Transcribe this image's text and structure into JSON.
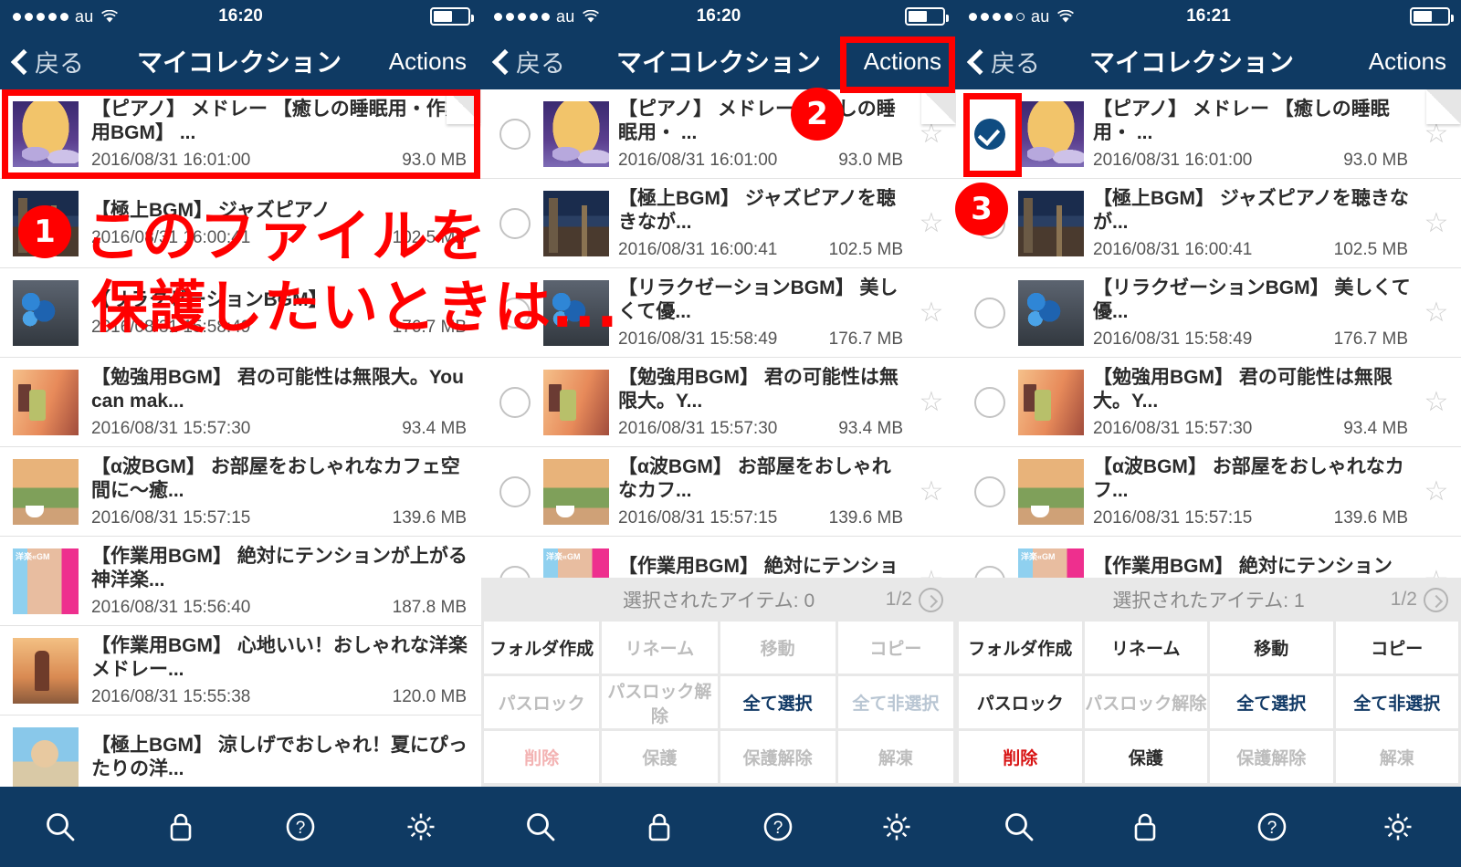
{
  "panels": [
    {
      "status": {
        "dots_filled": 5,
        "dots_total": 5,
        "carrier": "au",
        "time": "16:20",
        "battery_pct": 55
      },
      "nav": {
        "back": "戻る",
        "title": "マイコレクション",
        "actions": "Actions"
      },
      "mode": "plain",
      "rows": [
        {
          "title": "【ピアノ】 メドレー 【癒しの睡眠用・作業用BGM】 ...",
          "date": "2016/08/31 16:01:00",
          "size": "93.0 MB",
          "thumb": "t-moon",
          "corner": true,
          "selected": false
        },
        {
          "title": "【極上BGM】 ジャズピアノ",
          "date": "2016/08/31 16:00:41",
          "size": "102.5 MB",
          "thumb": "t-night",
          "corner": false,
          "selected": false
        },
        {
          "title": "【リラクゼーションBGM】",
          "date": "2016/08/31 15:58:49",
          "size": "176.7 MB",
          "thumb": "t-flower",
          "corner": false,
          "selected": false
        },
        {
          "title": "【勉強用BGM】 君の可能性は無限大。You can mak...",
          "date": "2016/08/31 15:57:30",
          "size": "93.4 MB",
          "thumb": "t-study",
          "corner": false,
          "selected": false
        },
        {
          "title": "【α波BGM】 お部屋をおしゃれなカフェ空間に〜癒...",
          "date": "2016/08/31 15:57:15",
          "size": "139.6 MB",
          "thumb": "t-cafe",
          "corner": false,
          "selected": false
        },
        {
          "title": "【作業用BGM】 絶対にテンションが上がる神洋楽...",
          "date": "2016/08/31 15:56:40",
          "size": "187.8 MB",
          "thumb": "t-idol",
          "corner": false,
          "selected": false
        },
        {
          "title": "【作業用BGM】 心地いい！おしゃれな洋楽メドレー...",
          "date": "2016/08/31 15:55:38",
          "size": "120.0 MB",
          "thumb": "t-walk",
          "corner": false,
          "selected": false
        },
        {
          "title": "【極上BGM】 涼しげでおしゃれ！夏にぴったりの洋...",
          "date": "",
          "size": "",
          "thumb": "t-beach",
          "corner": false,
          "selected": false
        }
      ],
      "sheet": null
    },
    {
      "status": {
        "dots_filled": 5,
        "dots_total": 5,
        "carrier": "au",
        "time": "16:20",
        "battery_pct": 55
      },
      "nav": {
        "back": "戻る",
        "title": "マイコレクション",
        "actions": "Actions"
      },
      "mode": "select",
      "rows": [
        {
          "title": "【ピアノ】 メドレー 【癒しの睡眠用・ ...",
          "date": "2016/08/31 16:01:00",
          "size": "93.0 MB",
          "thumb": "t-moon",
          "corner": true,
          "selected": false
        },
        {
          "title": "【極上BGM】 ジャズピアノを聴きなが...",
          "date": "2016/08/31 16:00:41",
          "size": "102.5 MB",
          "thumb": "t-night",
          "corner": false,
          "selected": false
        },
        {
          "title": "【リラクゼーションBGM】 美しくて優...",
          "date": "2016/08/31 15:58:49",
          "size": "176.7 MB",
          "thumb": "t-flower",
          "corner": false,
          "selected": false
        },
        {
          "title": "【勉強用BGM】 君の可能性は無限大。Y...",
          "date": "2016/08/31 15:57:30",
          "size": "93.4 MB",
          "thumb": "t-study",
          "corner": false,
          "selected": false
        },
        {
          "title": "【α波BGM】 お部屋をおしゃれなカフ...",
          "date": "2016/08/31 15:57:15",
          "size": "139.6 MB",
          "thumb": "t-cafe",
          "corner": false,
          "selected": false
        },
        {
          "title": "【作業用BGM】 絶対にテンションが...",
          "date": "",
          "size": "",
          "thumb": "t-idol",
          "corner": false,
          "selected": false
        }
      ],
      "sheet": {
        "count_label": "選択されたアイテム: 0",
        "page": "1/2",
        "buttons": [
          {
            "label": "フォルダ作成",
            "state": "enabled"
          },
          {
            "label": "リネーム",
            "state": "disabled"
          },
          {
            "label": "移動",
            "state": "disabled"
          },
          {
            "label": "コピー",
            "state": "disabled"
          },
          {
            "label": "パスロック",
            "state": "disabled"
          },
          {
            "label": "パスロック解除",
            "state": "disabled"
          },
          {
            "label": "全て選択",
            "state": "blue"
          },
          {
            "label": "全て非選択",
            "state": "blue-disabled"
          },
          {
            "label": "削除",
            "state": "red-disabled"
          },
          {
            "label": "保護",
            "state": "disabled"
          },
          {
            "label": "保護解除",
            "state": "disabled"
          },
          {
            "label": "解凍",
            "state": "disabled"
          }
        ]
      }
    },
    {
      "status": {
        "dots_filled": 4,
        "dots_total": 5,
        "carrier": "au",
        "time": "16:21",
        "battery_pct": 55
      },
      "nav": {
        "back": "戻る",
        "title": "マイコレクション",
        "actions": "Actions"
      },
      "mode": "select",
      "rows": [
        {
          "title": "【ピアノ】 メドレー 【癒しの睡眠用・ ...",
          "date": "2016/08/31 16:01:00",
          "size": "93.0 MB",
          "thumb": "t-moon",
          "corner": true,
          "selected": true
        },
        {
          "title": "【極上BGM】 ジャズピアノを聴きなが...",
          "date": "2016/08/31 16:00:41",
          "size": "102.5 MB",
          "thumb": "t-night",
          "corner": false,
          "selected": false
        },
        {
          "title": "【リラクゼーションBGM】 美しくて優...",
          "date": "2016/08/31 15:58:49",
          "size": "176.7 MB",
          "thumb": "t-flower",
          "corner": false,
          "selected": false
        },
        {
          "title": "【勉強用BGM】 君の可能性は無限大。Y...",
          "date": "2016/08/31 15:57:30",
          "size": "93.4 MB",
          "thumb": "t-study",
          "corner": false,
          "selected": false
        },
        {
          "title": "【α波BGM】 お部屋をおしゃれなカフ...",
          "date": "2016/08/31 15:57:15",
          "size": "139.6 MB",
          "thumb": "t-cafe",
          "corner": false,
          "selected": false
        },
        {
          "title": "【作業用BGM】 絶対にテンションが...",
          "date": "",
          "size": "",
          "thumb": "t-idol",
          "corner": false,
          "selected": false
        }
      ],
      "sheet": {
        "count_label": "選択されたアイテム: 1",
        "page": "1/2",
        "buttons": [
          {
            "label": "フォルダ作成",
            "state": "enabled"
          },
          {
            "label": "リネーム",
            "state": "enabled"
          },
          {
            "label": "移動",
            "state": "enabled"
          },
          {
            "label": "コピー",
            "state": "enabled"
          },
          {
            "label": "パスロック",
            "state": "enabled"
          },
          {
            "label": "パスロック解除",
            "state": "disabled"
          },
          {
            "label": "全て選択",
            "state": "blue"
          },
          {
            "label": "全て非選択",
            "state": "blue"
          },
          {
            "label": "削除",
            "state": "red"
          },
          {
            "label": "保護",
            "state": "enabled"
          },
          {
            "label": "保護解除",
            "state": "disabled"
          },
          {
            "label": "解凍",
            "state": "disabled"
          }
        ]
      }
    }
  ],
  "toolbar": {
    "items": [
      {
        "icon": "search-icon"
      },
      {
        "icon": "lock-icon"
      },
      {
        "icon": "help-icon"
      },
      {
        "icon": "gear-icon"
      }
    ]
  },
  "annotations": {
    "badge1": "1",
    "badge2": "2",
    "badge3": "3",
    "line1": "このファイルを",
    "line2": "保護したいときは...",
    "accent_color": "#ff0000"
  },
  "colors": {
    "navy": "#0f3a63",
    "accent_blue": "#123a66",
    "red": "#d81414"
  }
}
